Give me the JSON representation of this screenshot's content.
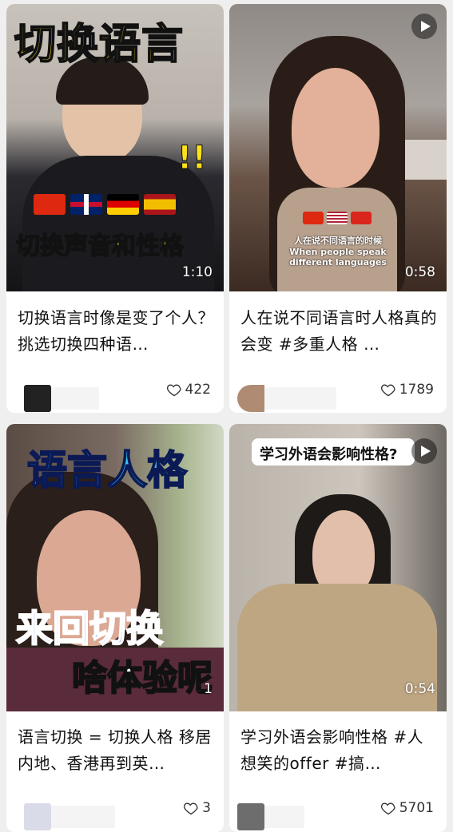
{
  "cards": [
    {
      "title": "切换语言时像是变了个人？挑选切换四种语…",
      "likes": "422",
      "duration": "1:10",
      "overlay_top": "切换语言",
      "overlay_bottom": "切换声音和性格",
      "exclaim": "!!"
    },
    {
      "title": "人在说不同语言时人格真的会变 #多重人格 …",
      "likes": "1789",
      "duration": "0:58",
      "subtitle_zh": "人在说不同语言的时候",
      "subtitle_en": "When people speak different languages"
    },
    {
      "title": "语言切换 = 切换人格 移居内地、香港再到英…",
      "likes": "3",
      "duration": "1",
      "overlay_top": "语言人格",
      "overlay_mid": "来回切换",
      "overlay_bottom": "啥体验呢"
    },
    {
      "title": "学习外语会影响性格 #人想笑的offer #搞…",
      "likes": "5701",
      "duration": "0:54",
      "overlay_top": "学习外语会影响性格?"
    }
  ],
  "colors": {
    "page_bg": "#efefef",
    "like_icon": "#333333"
  }
}
